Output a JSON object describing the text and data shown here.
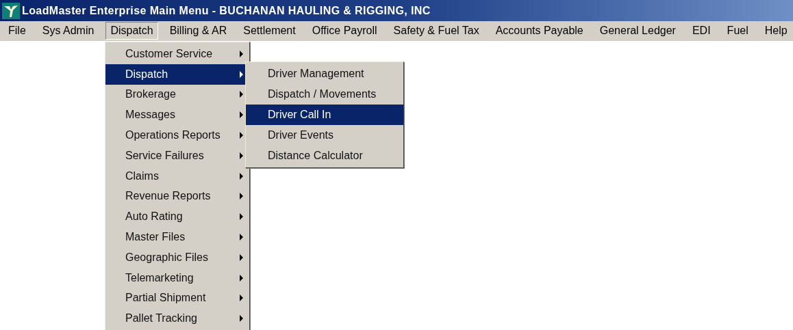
{
  "window": {
    "title": "LoadMaster Enterprise Main Menu - BUCHANAN HAULING & RIGGING, INC"
  },
  "menu_bar": [
    {
      "label": "File",
      "selected": false
    },
    {
      "label": "Sys Admin",
      "selected": false
    },
    {
      "label": "Dispatch",
      "selected": true
    },
    {
      "label": "Billing & AR",
      "selected": false
    },
    {
      "label": "Settlement",
      "selected": false
    },
    {
      "label": "Office Payroll",
      "selected": false
    },
    {
      "label": "Safety & Fuel Tax",
      "selected": false
    },
    {
      "label": "Accounts Payable",
      "selected": false
    },
    {
      "label": "General Ledger",
      "selected": false
    },
    {
      "label": "EDI",
      "selected": false
    },
    {
      "label": "Fuel",
      "selected": false
    },
    {
      "label": "Help",
      "selected": false
    }
  ],
  "dropdown": [
    {
      "label": "Customer Service",
      "selected": false,
      "submenu": true
    },
    {
      "label": "Dispatch",
      "selected": true,
      "submenu": true
    },
    {
      "label": "Brokerage",
      "selected": false,
      "submenu": true
    },
    {
      "label": "Messages",
      "selected": false,
      "submenu": true
    },
    {
      "label": "Operations Reports",
      "selected": false,
      "submenu": true
    },
    {
      "label": "Service Failures",
      "selected": false,
      "submenu": true
    },
    {
      "label": "Claims",
      "selected": false,
      "submenu": true
    },
    {
      "label": "Revenue Reports",
      "selected": false,
      "submenu": true
    },
    {
      "label": "Auto Rating",
      "selected": false,
      "submenu": true
    },
    {
      "label": "Master Files",
      "selected": false,
      "submenu": true
    },
    {
      "label": "Geographic Files",
      "selected": false,
      "submenu": true
    },
    {
      "label": "Telemarketing",
      "selected": false,
      "submenu": true
    },
    {
      "label": "Partial Shipment",
      "selected": false,
      "submenu": true
    },
    {
      "label": "Pallet Tracking",
      "selected": false,
      "submenu": true
    }
  ],
  "submenu": [
    {
      "label": "Driver Management",
      "selected": false
    },
    {
      "label": "Dispatch / Movements",
      "selected": false
    },
    {
      "label": "Driver Call In",
      "selected": true
    },
    {
      "label": "Driver Events",
      "selected": false
    },
    {
      "label": "Distance Calculator",
      "selected": false
    }
  ]
}
